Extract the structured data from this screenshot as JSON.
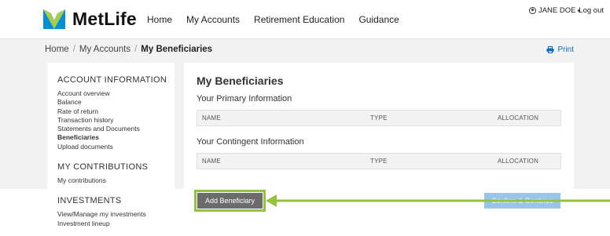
{
  "header": {
    "brand": "MetLife",
    "nav": [
      "Home",
      "My Accounts",
      "Retirement Education",
      "Guidance"
    ],
    "user": "JANE DOE",
    "logout": "Log out"
  },
  "breadcrumb": {
    "home": "Home",
    "accounts": "My Accounts",
    "current": "My Beneficiaries"
  },
  "print_label": "Print",
  "sidebar": {
    "account_info": {
      "heading": "ACCOUNT INFORMATION",
      "items": [
        "Account overview",
        "Balance",
        "Rate of return",
        "Transaction history",
        "Statements and Documents",
        "Beneficiaries",
        "Upload documents"
      ],
      "active": "Beneficiaries"
    },
    "contributions": {
      "heading": "MY CONTRIBUTIONS",
      "items": [
        "My contributions"
      ]
    },
    "investments": {
      "heading": "INVESTMENTS",
      "items": [
        "View/Manage my investments",
        "Investment lineup"
      ]
    }
  },
  "main": {
    "title": "My Beneficiaries",
    "primary_heading": "Your Primary Information",
    "contingent_heading": "Your Contingent Information",
    "columns": [
      "NAME",
      "TYPE",
      "ALLOCATION"
    ]
  },
  "buttons": {
    "add": "Add Beneficiary",
    "confirm": "Confirm & Continue"
  },
  "colors": {
    "logo_blue": "#0090da",
    "logo_green": "#a4ce4e",
    "highlight_green": "#93c33d",
    "link_blue": "#0a6bc2",
    "confirm_bg": "#9ac5ea",
    "add_bg": "#6b6b6b"
  }
}
